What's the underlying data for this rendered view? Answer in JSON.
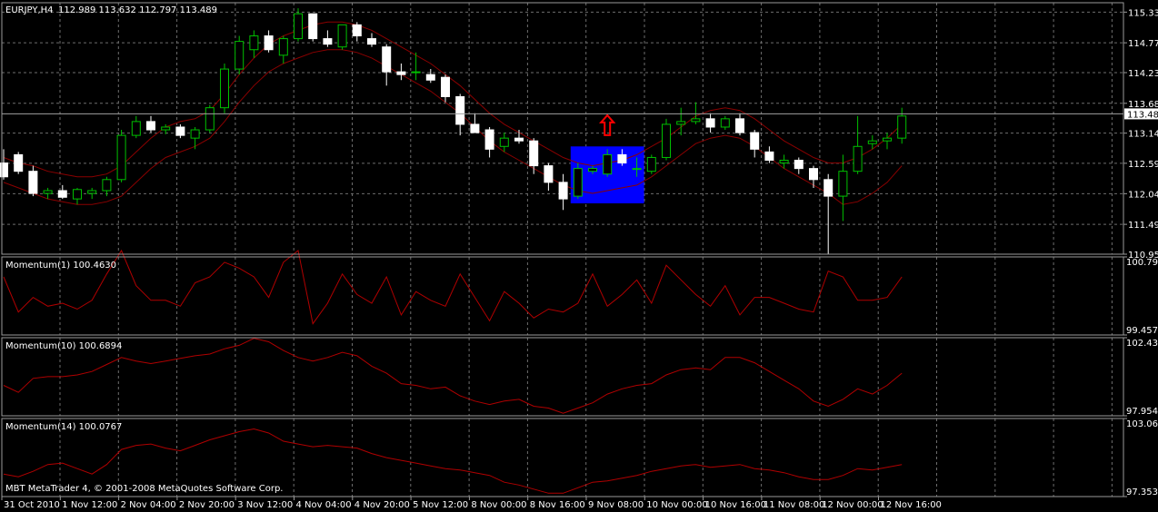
{
  "colors": {
    "background": "#000000",
    "grid": "#6e6e6e",
    "frame": "#9a9a9a",
    "bull": "#00c000",
    "bear": "#ffffff",
    "envelope": "#8b0000",
    "momentum": "#b00000",
    "highlight": "#0000ff",
    "arrow": "#ff0000",
    "text": "#ffffff"
  },
  "header": {
    "title": "EURJPY,H4",
    "ohlc": "112.989 113.632 112.797 113.489"
  },
  "footer": {
    "copyright": "MBT MetaTrader 4, © 2001-2008 MetaQuotes Software Corp."
  },
  "time_axis": {
    "labels": [
      "31 Oct 2010",
      "1 Nov 12:00",
      "2 Nov 04:00",
      "2 Nov 20:00",
      "3 Nov 12:00",
      "4 Nov 04:00",
      "4 Nov 20:00",
      "5 Nov 12:00",
      "8 Nov 00:00",
      "8 Nov 16:00",
      "9 Nov 08:00",
      "10 Nov 00:00",
      "10 Nov 16:00",
      "11 Nov 08:00",
      "12 Nov 00:00",
      "12 Nov 16:00"
    ]
  },
  "chart_data": [
    {
      "type": "candlestick",
      "title": "EURJPY,H4",
      "ylim": [
        110.95,
        115.5
      ],
      "y_ticks": [
        "115.330",
        "114.775",
        "114.235",
        "113.680",
        "113.140",
        "112.595",
        "112.045",
        "111.490",
        "110.950"
      ],
      "current_price": "113.489",
      "grid": true,
      "candles": [
        [
          112.6,
          112.85,
          112.3,
          112.35
        ],
        [
          112.75,
          112.8,
          112.4,
          112.45
        ],
        [
          112.45,
          112.55,
          112.0,
          112.05
        ],
        [
          112.05,
          112.15,
          111.95,
          112.1
        ],
        [
          112.1,
          112.2,
          111.95,
          111.98
        ],
        [
          111.95,
          112.15,
          111.85,
          112.12
        ],
        [
          112.05,
          112.15,
          111.95,
          112.1
        ],
        [
          112.1,
          112.35,
          112.0,
          112.3
        ],
        [
          112.3,
          113.2,
          112.25,
          113.1
        ],
        [
          113.1,
          113.45,
          113.05,
          113.35
        ],
        [
          113.35,
          113.45,
          113.15,
          113.2
        ],
        [
          113.2,
          113.3,
          113.12,
          113.25
        ],
        [
          113.25,
          113.3,
          113.05,
          113.1
        ],
        [
          113.05,
          113.25,
          112.85,
          113.2
        ],
        [
          113.2,
          113.65,
          113.15,
          113.6
        ],
        [
          113.6,
          114.4,
          113.5,
          114.3
        ],
        [
          114.3,
          114.9,
          114.2,
          114.8
        ],
        [
          114.65,
          115.0,
          114.5,
          114.9
        ],
        [
          114.9,
          115.0,
          114.6,
          114.65
        ],
        [
          114.55,
          114.9,
          114.4,
          114.85
        ],
        [
          114.85,
          115.4,
          114.8,
          115.3
        ],
        [
          115.3,
          115.3,
          114.8,
          114.85
        ],
        [
          114.85,
          115.0,
          114.7,
          114.75
        ],
        [
          114.7,
          115.1,
          114.65,
          115.1
        ],
        [
          115.1,
          115.15,
          114.8,
          114.9
        ],
        [
          114.85,
          114.95,
          114.7,
          114.75
        ],
        [
          114.7,
          114.75,
          114.0,
          114.25
        ],
        [
          114.25,
          114.4,
          114.1,
          114.2
        ],
        [
          114.25,
          114.6,
          114.1,
          114.25
        ],
        [
          114.2,
          114.3,
          114.05,
          114.1
        ],
        [
          114.15,
          114.2,
          113.7,
          113.8
        ],
        [
          113.8,
          113.85,
          113.1,
          113.3
        ],
        [
          113.3,
          113.5,
          113.2,
          113.15
        ],
        [
          113.2,
          113.25,
          112.7,
          112.85
        ],
        [
          112.9,
          113.15,
          112.8,
          113.05
        ],
        [
          113.05,
          113.2,
          112.95,
          113.0
        ],
        [
          113.0,
          113.05,
          112.4,
          112.55
        ],
        [
          112.55,
          112.6,
          112.1,
          112.25
        ],
        [
          112.25,
          112.4,
          111.75,
          111.95
        ],
        [
          112.0,
          112.6,
          111.95,
          112.5
        ],
        [
          112.45,
          112.55,
          112.4,
          112.5
        ],
        [
          112.4,
          112.85,
          112.35,
          112.75
        ],
        [
          112.75,
          112.85,
          112.55,
          112.6
        ],
        [
          112.5,
          112.7,
          112.35,
          112.5
        ],
        [
          112.45,
          112.75,
          112.4,
          112.7
        ],
        [
          112.7,
          113.4,
          112.65,
          113.3
        ],
        [
          113.3,
          113.6,
          113.1,
          113.35
        ],
        [
          113.35,
          113.7,
          113.3,
          113.4
        ],
        [
          113.4,
          113.5,
          113.15,
          113.25
        ],
        [
          113.25,
          113.45,
          113.2,
          113.4
        ],
        [
          113.4,
          113.5,
          113.1,
          113.15
        ],
        [
          113.15,
          113.2,
          112.7,
          112.85
        ],
        [
          112.8,
          112.9,
          112.6,
          112.65
        ],
        [
          112.6,
          112.75,
          112.5,
          112.65
        ],
        [
          112.65,
          112.7,
          112.4,
          112.5
        ],
        [
          112.5,
          112.55,
          112.15,
          112.3
        ],
        [
          112.3,
          112.4,
          110.95,
          112.0
        ],
        [
          112.0,
          112.75,
          111.55,
          112.45
        ],
        [
          112.45,
          113.45,
          112.4,
          112.9
        ],
        [
          112.95,
          113.1,
          112.85,
          113.0
        ],
        [
          113.0,
          113.15,
          112.85,
          113.05
        ],
        [
          113.05,
          113.6,
          112.95,
          113.45
        ]
      ],
      "upper_envelope": [
        112.7,
        112.6,
        112.55,
        112.45,
        112.4,
        112.35,
        112.35,
        112.4,
        112.55,
        112.8,
        113.05,
        113.25,
        113.35,
        113.4,
        113.55,
        113.85,
        114.2,
        114.5,
        114.75,
        114.9,
        115.0,
        115.1,
        115.15,
        115.15,
        115.1,
        115.0,
        114.85,
        114.7,
        114.55,
        114.4,
        114.2,
        114.0,
        113.75,
        113.5,
        113.3,
        113.15,
        113.0,
        112.85,
        112.7,
        112.6,
        112.55,
        112.6,
        112.65,
        112.75,
        112.9,
        113.05,
        113.25,
        113.45,
        113.55,
        113.6,
        113.55,
        113.4,
        113.2,
        113.0,
        112.85,
        112.7,
        112.6,
        112.6,
        112.7,
        112.85,
        113.05,
        113.3
      ],
      "lower_envelope": [
        112.25,
        112.15,
        112.05,
        111.95,
        111.9,
        111.85,
        111.85,
        111.9,
        112.0,
        112.25,
        112.5,
        112.7,
        112.8,
        112.9,
        113.05,
        113.35,
        113.7,
        114.0,
        114.25,
        114.4,
        114.5,
        114.6,
        114.65,
        114.65,
        114.6,
        114.5,
        114.35,
        114.2,
        114.05,
        113.9,
        113.7,
        113.5,
        113.25,
        113.0,
        112.8,
        112.65,
        112.5,
        112.35,
        112.2,
        112.1,
        112.05,
        112.1,
        112.15,
        112.2,
        112.35,
        112.55,
        112.75,
        112.95,
        113.05,
        113.1,
        113.05,
        112.9,
        112.7,
        112.5,
        112.35,
        112.2,
        112.05,
        111.85,
        111.9,
        112.05,
        112.25,
        112.55
      ],
      "highlight_range": [
        39,
        43
      ],
      "signal_index": 41,
      "signal_price": 113.3
    },
    {
      "type": "line",
      "title": "Momentum(1) 100.4630",
      "ylim": [
        99.4576,
        100.792
      ],
      "y_ticks": [
        "100.792",
        "99.4576"
      ],
      "series": [
        {
          "values": [
            100.45,
            99.85,
            100.1,
            99.95,
            100.0,
            99.9,
            100.05,
            100.5,
            100.9,
            100.3,
            100.05,
            100.05,
            99.95,
            100.35,
            100.45,
            100.7,
            100.6,
            100.45,
            100.1,
            100.7,
            100.9,
            99.65,
            100.0,
            100.5,
            100.15,
            100.0,
            100.45,
            99.8,
            100.2,
            100.05,
            99.95,
            100.5,
            100.1,
            99.7,
            100.2,
            100.0,
            99.75,
            99.9,
            99.85,
            100.0,
            100.5,
            99.95,
            100.15,
            100.4,
            100.0,
            100.65,
            100.4,
            100.15,
            99.95,
            100.3,
            99.8,
            100.1,
            100.1,
            100.0,
            99.9,
            99.85,
            100.55,
            100.45,
            100.05,
            100.05,
            100.1,
            100.45
          ]
        }
      ]
    },
    {
      "type": "line",
      "title": "Momentum(10) 100.6894",
      "ylim": [
        97.9544,
        102.437
      ],
      "y_ticks": [
        "102.437",
        "97.9544"
      ],
      "series": [
        {
          "values": [
            99.7,
            99.3,
            100.1,
            100.2,
            100.2,
            100.3,
            100.5,
            100.9,
            101.3,
            101.1,
            100.95,
            101.1,
            101.25,
            101.4,
            101.5,
            101.8,
            102.0,
            102.4,
            102.2,
            101.7,
            101.3,
            101.1,
            101.3,
            101.6,
            101.4,
            100.8,
            100.4,
            99.8,
            99.7,
            99.5,
            99.6,
            99.1,
            98.8,
            98.6,
            98.8,
            98.9,
            98.5,
            98.4,
            98.1,
            98.4,
            98.7,
            99.2,
            99.5,
            99.7,
            99.8,
            100.3,
            100.6,
            100.7,
            100.6,
            101.3,
            101.3,
            101.0,
            100.5,
            100.0,
            99.5,
            98.8,
            98.5,
            98.9,
            99.5,
            99.2,
            99.7,
            100.4
          ]
        }
      ]
    },
    {
      "type": "line",
      "title": "Momentum(14) 100.0767",
      "ylim": [
        97.3539,
        103.062
      ],
      "y_ticks": [
        "103.062",
        "97.3539"
      ],
      "series": [
        {
          "values": [
            99.0,
            98.8,
            99.2,
            99.7,
            99.8,
            99.4,
            99.0,
            99.7,
            100.8,
            101.1,
            101.2,
            100.9,
            100.7,
            101.1,
            101.5,
            101.8,
            102.1,
            102.3,
            102.0,
            101.4,
            101.2,
            101.0,
            101.1,
            101.0,
            100.9,
            100.5,
            100.2,
            100.0,
            99.8,
            99.6,
            99.4,
            99.3,
            99.1,
            98.9,
            98.4,
            98.2,
            97.9,
            97.6,
            97.6,
            98.0,
            98.4,
            98.5,
            98.7,
            98.9,
            99.2,
            99.4,
            99.6,
            99.7,
            99.5,
            99.6,
            99.7,
            99.4,
            99.3,
            99.1,
            98.8,
            98.6,
            98.6,
            98.9,
            99.4,
            99.3,
            99.5,
            99.7
          ]
        }
      ]
    }
  ]
}
